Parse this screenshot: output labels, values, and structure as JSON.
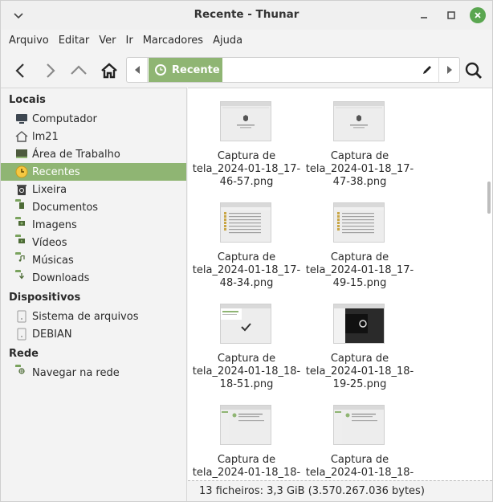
{
  "window": {
    "title": "Recente - Thunar"
  },
  "menubar": {
    "items": [
      "Arquivo",
      "Editar",
      "Ver",
      "Ir",
      "Marcadores",
      "Ajuda"
    ]
  },
  "pathbar": {
    "crumb": "Recente"
  },
  "sidebar": {
    "sections": [
      {
        "heading": "Locais",
        "items": [
          {
            "label": "Computador",
            "icon": "computer-icon"
          },
          {
            "label": "lm21",
            "icon": "home-icon"
          },
          {
            "label": "Área de Trabalho",
            "icon": "desktop-icon"
          },
          {
            "label": "Recentes",
            "icon": "clock-icon",
            "active": true
          },
          {
            "label": "Lixeira",
            "icon": "trash-icon"
          },
          {
            "label": "Documentos",
            "icon": "folder-documents-icon"
          },
          {
            "label": "Imagens",
            "icon": "folder-pictures-icon"
          },
          {
            "label": "Vídeos",
            "icon": "folder-videos-icon"
          },
          {
            "label": "Músicas",
            "icon": "folder-music-icon"
          },
          {
            "label": "Downloads",
            "icon": "folder-downloads-icon"
          }
        ]
      },
      {
        "heading": "Dispositivos",
        "items": [
          {
            "label": "Sistema de arquivos",
            "icon": "drive-icon"
          },
          {
            "label": "DEBIAN",
            "icon": "drive-icon"
          }
        ]
      },
      {
        "heading": "Rede",
        "items": [
          {
            "label": "Navegar na rede",
            "icon": "network-folder-icon"
          }
        ]
      }
    ]
  },
  "files": [
    {
      "line1": "Captura de",
      "line2": "tela_2024-01-18_17-",
      "line3": "46-57.png",
      "thumb": "shield"
    },
    {
      "line1": "Captura de",
      "line2": "tela_2024-01-18_17-",
      "line3": "47-38.png",
      "thumb": "shield"
    },
    {
      "line1": "Captura de",
      "line2": "tela_2024-01-18_17-",
      "line3": "48-34.png",
      "thumb": "list"
    },
    {
      "line1": "Captura de",
      "line2": "tela_2024-01-18_17-",
      "line3": "49-15.png",
      "thumb": "list"
    },
    {
      "line1": "Captura de",
      "line2": "tela_2024-01-18_18-",
      "line3": "18-51.png",
      "thumb": "check"
    },
    {
      "line1": "Captura de",
      "line2": "tela_2024-01-18_18-",
      "line3": "19-25.png",
      "thumb": "dark"
    },
    {
      "line1": "Captura de",
      "line2": "tela_2024-01-18_18-",
      "line3": "",
      "thumb": "text"
    },
    {
      "line1": "Captura de",
      "line2": "tela_2024-01-18_18-",
      "line3": "",
      "thumb": "text"
    }
  ],
  "statusbar": {
    "text": "13 ficheiros: 3,3 GiB (3.570.267.036 bytes)"
  },
  "colors": {
    "accent": "#8fb573",
    "close": "#5aa650"
  }
}
